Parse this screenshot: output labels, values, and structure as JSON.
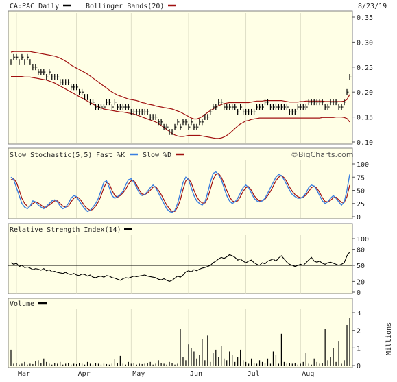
{
  "header": {
    "symbol_label": "CA:PAC Daily",
    "overlay_label": "Bollinger Bands(20)",
    "date": "8/23/19",
    "watermark": "©BigCharts.com"
  },
  "colors": {
    "panel_bg": "#ffffe6",
    "price": "#000000",
    "bollinger": "#a01010",
    "fast_k": "#3a7fe0",
    "slow_d": "#a01010",
    "rsi": "#000000",
    "volume": "#000000"
  },
  "chart_data": [
    {
      "id": "price",
      "type": "line",
      "title": "CA:PAC Daily",
      "ylim": [
        0.1,
        0.35
      ],
      "yticks": [
        "0.35",
        "0.30",
        "0.25",
        "0.20",
        "0.15",
        "0.10"
      ],
      "ytick_values": [
        0.35,
        0.3,
        0.25,
        0.2,
        0.15,
        0.1
      ],
      "x_range": [
        0,
        124
      ],
      "series": [
        {
          "name": "CA:PAC Daily",
          "style": "ohlc-bars",
          "values": [
            0.26,
            0.27,
            0.27,
            0.26,
            0.27,
            0.26,
            0.27,
            0.26,
            0.25,
            0.25,
            0.24,
            0.24,
            0.24,
            0.23,
            0.24,
            0.23,
            0.23,
            0.23,
            0.22,
            0.22,
            0.22,
            0.22,
            0.21,
            0.21,
            0.21,
            0.2,
            0.2,
            0.19,
            0.19,
            0.18,
            0.18,
            0.17,
            0.17,
            0.17,
            0.17,
            0.18,
            0.18,
            0.17,
            0.18,
            0.17,
            0.17,
            0.17,
            0.17,
            0.17,
            0.16,
            0.16,
            0.16,
            0.16,
            0.16,
            0.16,
            0.16,
            0.15,
            0.15,
            0.15,
            0.14,
            0.14,
            0.13,
            0.13,
            0.12,
            0.12,
            0.13,
            0.14,
            0.13,
            0.14,
            0.14,
            0.13,
            0.14,
            0.13,
            0.13,
            0.14,
            0.14,
            0.15,
            0.15,
            0.16,
            0.17,
            0.17,
            0.18,
            0.18,
            0.17,
            0.17,
            0.17,
            0.17,
            0.17,
            0.16,
            0.17,
            0.16,
            0.16,
            0.16,
            0.16,
            0.16,
            0.17,
            0.17,
            0.17,
            0.18,
            0.18,
            0.17,
            0.17,
            0.17,
            0.17,
            0.17,
            0.17,
            0.17,
            0.16,
            0.16,
            0.16,
            0.17,
            0.17,
            0.17,
            0.17,
            0.18,
            0.18,
            0.18,
            0.18,
            0.18,
            0.18,
            0.17,
            0.17,
            0.18,
            0.18,
            0.18,
            0.17,
            0.17,
            0.18,
            0.2,
            0.23
          ]
        },
        {
          "name": "Bollinger Bands(20)",
          "band": "upper",
          "values": [
            0.28,
            0.281,
            0.281,
            0.281,
            0.281,
            0.281,
            0.281,
            0.281,
            0.28,
            0.279,
            0.278,
            0.277,
            0.276,
            0.275,
            0.274,
            0.273,
            0.272,
            0.27,
            0.268,
            0.265,
            0.262,
            0.258,
            0.254,
            0.251,
            0.248,
            0.245,
            0.242,
            0.239,
            0.236,
            0.232,
            0.228,
            0.224,
            0.22,
            0.216,
            0.212,
            0.208,
            0.204,
            0.2,
            0.197,
            0.194,
            0.192,
            0.19,
            0.188,
            0.186,
            0.185,
            0.184,
            0.183,
            0.181,
            0.179,
            0.178,
            0.176,
            0.175,
            0.174,
            0.172,
            0.171,
            0.17,
            0.169,
            0.168,
            0.167,
            0.166,
            0.164,
            0.162,
            0.16,
            0.157,
            0.154,
            0.151,
            0.148,
            0.146,
            0.146,
            0.148,
            0.151,
            0.155,
            0.159,
            0.163,
            0.166,
            0.17,
            0.173,
            0.175,
            0.177,
            0.178,
            0.179,
            0.179,
            0.179,
            0.179,
            0.179,
            0.179,
            0.179,
            0.179,
            0.18,
            0.181,
            0.182,
            0.182,
            0.182,
            0.183,
            0.183,
            0.183,
            0.183,
            0.183,
            0.183,
            0.183,
            0.182,
            0.181,
            0.18,
            0.18,
            0.18,
            0.18,
            0.181,
            0.181,
            0.182,
            0.182,
            0.182,
            0.182,
            0.182,
            0.182,
            0.182,
            0.181,
            0.181,
            0.181,
            0.181,
            0.181,
            0.181,
            0.181,
            0.182,
            0.185,
            0.195
          ]
        },
        {
          "name": "Bollinger Bands(20)",
          "band": "lower",
          "values": [
            0.231,
            0.231,
            0.231,
            0.231,
            0.231,
            0.23,
            0.23,
            0.23,
            0.229,
            0.228,
            0.227,
            0.226,
            0.225,
            0.224,
            0.222,
            0.22,
            0.218,
            0.215,
            0.212,
            0.209,
            0.206,
            0.203,
            0.2,
            0.197,
            0.194,
            0.191,
            0.188,
            0.185,
            0.182,
            0.179,
            0.176,
            0.173,
            0.17,
            0.168,
            0.166,
            0.165,
            0.164,
            0.163,
            0.162,
            0.161,
            0.16,
            0.16,
            0.159,
            0.158,
            0.157,
            0.156,
            0.154,
            0.152,
            0.15,
            0.148,
            0.146,
            0.144,
            0.142,
            0.14,
            0.137,
            0.133,
            0.129,
            0.125,
            0.121,
            0.117,
            0.114,
            0.112,
            0.111,
            0.111,
            0.112,
            0.113,
            0.113,
            0.113,
            0.113,
            0.113,
            0.112,
            0.111,
            0.11,
            0.109,
            0.108,
            0.107,
            0.107,
            0.108,
            0.11,
            0.113,
            0.117,
            0.122,
            0.127,
            0.132,
            0.136,
            0.139,
            0.142,
            0.143,
            0.145,
            0.146,
            0.147,
            0.148,
            0.148,
            0.148,
            0.148,
            0.148,
            0.148,
            0.148,
            0.148,
            0.148,
            0.148,
            0.148,
            0.148,
            0.148,
            0.148,
            0.148,
            0.148,
            0.148,
            0.148,
            0.148,
            0.148,
            0.148,
            0.148,
            0.148,
            0.149,
            0.149,
            0.149,
            0.149,
            0.149,
            0.15,
            0.15,
            0.15,
            0.149,
            0.147,
            0.14
          ]
        }
      ]
    },
    {
      "id": "stochastic",
      "type": "line",
      "title": "Slow Stochastic(5,5)",
      "ylim": [
        0,
        100
      ],
      "yticks": [
        "100",
        "75",
        "50",
        "25",
        "0"
      ],
      "ytick_values": [
        100,
        75,
        50,
        25,
        0
      ],
      "x_range": [
        0,
        124
      ],
      "series": [
        {
          "name": "Fast %K",
          "values": [
            75,
            70,
            55,
            40,
            25,
            18,
            15,
            20,
            30,
            28,
            22,
            18,
            15,
            20,
            25,
            30,
            32,
            28,
            20,
            15,
            18,
            25,
            35,
            40,
            38,
            30,
            22,
            15,
            10,
            12,
            18,
            25,
            35,
            50,
            65,
            68,
            55,
            40,
            35,
            38,
            42,
            48,
            60,
            70,
            72,
            65,
            55,
            45,
            40,
            42,
            48,
            55,
            60,
            55,
            45,
            35,
            25,
            15,
            10,
            8,
            12,
            25,
            45,
            65,
            75,
            70,
            55,
            40,
            30,
            25,
            22,
            28,
            45,
            65,
            82,
            85,
            80,
            70,
            55,
            40,
            30,
            25,
            28,
            35,
            45,
            55,
            60,
            55,
            45,
            35,
            30,
            28,
            30,
            35,
            45,
            55,
            65,
            75,
            80,
            78,
            70,
            60,
            50,
            42,
            38,
            35,
            35,
            38,
            45,
            55,
            60,
            58,
            50,
            40,
            30,
            25,
            28,
            35,
            40,
            35,
            28,
            22,
            28,
            50,
            80
          ]
        },
        {
          "name": "Slow %D",
          "values": [
            70,
            72,
            65,
            50,
            35,
            25,
            20,
            20,
            25,
            28,
            26,
            22,
            18,
            18,
            22,
            26,
            30,
            30,
            25,
            20,
            18,
            20,
            28,
            35,
            38,
            35,
            28,
            20,
            15,
            12,
            14,
            20,
            28,
            40,
            55,
            65,
            62,
            50,
            40,
            37,
            40,
            45,
            52,
            62,
            68,
            68,
            60,
            50,
            43,
            42,
            45,
            50,
            56,
            57,
            50,
            42,
            32,
            22,
            15,
            10,
            10,
            18,
            32,
            52,
            68,
            72,
            64,
            50,
            38,
            30,
            26,
            26,
            35,
            52,
            70,
            80,
            82,
            75,
            63,
            50,
            38,
            30,
            28,
            30,
            38,
            48,
            55,
            57,
            50,
            40,
            34,
            30,
            30,
            33,
            40,
            48,
            58,
            68,
            75,
            78,
            74,
            66,
            56,
            48,
            42,
            38,
            36,
            37,
            41,
            48,
            55,
            58,
            54,
            46,
            36,
            29,
            28,
            31,
            36,
            37,
            32,
            27,
            27,
            38,
            60
          ]
        }
      ]
    },
    {
      "id": "rsi",
      "type": "line",
      "title": "Relative Strength Index(14)",
      "ylim": [
        0,
        100
      ],
      "yticks": [
        "100",
        "80",
        "50",
        "20",
        "0"
      ],
      "ytick_values": [
        100,
        80,
        50,
        20,
        0
      ],
      "reference_line": 50,
      "x_range": [
        0,
        124
      ],
      "series": [
        {
          "name": "Relative Strength Index(14)",
          "values": [
            55,
            52,
            54,
            48,
            50,
            46,
            47,
            45,
            42,
            44,
            43,
            41,
            44,
            40,
            42,
            38,
            39,
            37,
            36,
            35,
            37,
            34,
            33,
            35,
            32,
            31,
            34,
            33,
            30,
            32,
            28,
            27,
            29,
            30,
            28,
            31,
            30,
            27,
            26,
            24,
            22,
            25,
            27,
            26,
            28,
            30,
            29,
            30,
            31,
            32,
            30,
            29,
            28,
            27,
            24,
            23,
            25,
            22,
            20,
            22,
            26,
            30,
            28,
            32,
            38,
            40,
            38,
            42,
            40,
            43,
            45,
            46,
            48,
            50,
            55,
            58,
            62,
            65,
            63,
            66,
            70,
            68,
            65,
            60,
            62,
            58,
            55,
            58,
            60,
            55,
            52,
            50,
            55,
            53,
            58,
            60,
            62,
            58,
            64,
            68,
            62,
            56,
            52,
            50,
            48,
            50,
            52,
            50,
            55,
            60,
            65,
            58,
            56,
            58,
            54,
            52,
            55,
            56,
            54,
            52,
            50,
            52,
            55,
            68,
            75
          ]
        }
      ]
    },
    {
      "id": "volume",
      "type": "bar",
      "title": "Volume",
      "ylabel": "Millions",
      "ylim": [
        0,
        3
      ],
      "yticks": [
        "3",
        "2",
        "1",
        "0"
      ],
      "ytick_values": [
        3,
        2,
        1,
        0
      ],
      "x_range": [
        0,
        124
      ],
      "values": [
        0.9,
        0.1,
        0.15,
        0.05,
        0.1,
        0.2,
        0.05,
        0.1,
        0.08,
        0.25,
        0.3,
        0.15,
        0.4,
        0.2,
        0.1,
        0.05,
        0.15,
        0.1,
        0.2,
        0.05,
        0.1,
        0.15,
        0.05,
        0.1,
        0.08,
        0.15,
        0.1,
        0.05,
        0.2,
        0.1,
        0.05,
        0.15,
        0.1,
        0.05,
        0.1,
        0.08,
        0.05,
        0.1,
        0.35,
        0.15,
        0.55,
        0.1,
        0.05,
        0.2,
        0.1,
        0.15,
        0.05,
        0.1,
        0.08,
        0.1,
        0.15,
        0.2,
        0.05,
        0.1,
        0.3,
        0.15,
        0.1,
        0.05,
        0.2,
        0.15,
        0.05,
        0.1,
        2.1,
        0.5,
        0.3,
        1.2,
        1.0,
        0.8,
        0.4,
        0.6,
        1.5,
        0.3,
        1.7,
        0.2,
        0.7,
        0.9,
        0.5,
        1.1,
        0.4,
        0.3,
        0.8,
        0.6,
        0.2,
        0.5,
        0.9,
        0.3,
        0.2,
        0.1,
        0.4,
        0.15,
        0.1,
        0.3,
        0.2,
        0.15,
        0.4,
        0.1,
        0.8,
        0.6,
        0.1,
        1.8,
        0.2,
        0.1,
        0.15,
        0.1,
        0.15,
        0.05,
        0.1,
        0.2,
        0.7,
        0.1,
        0.05,
        0.4,
        0.2,
        0.1,
        0.15,
        2.1,
        0.3,
        0.5,
        1.0,
        0.2,
        1.4,
        0.1,
        0.3,
        2.3,
        2.7
      ]
    }
  ],
  "x_axis": {
    "months": [
      {
        "label": "Mar",
        "index": 2
      },
      {
        "label": "Apr",
        "index": 24
      },
      {
        "label": "May",
        "index": 44
      },
      {
        "label": "Jun",
        "index": 65
      },
      {
        "label": "Jul",
        "index": 86
      },
      {
        "label": "Aug",
        "index": 106
      }
    ]
  },
  "panels": {
    "stochastic": {
      "title": "Slow Stochastic(5,5)",
      "fast_label": "Fast %K",
      "slow_label": "Slow %D"
    },
    "rsi": {
      "title": "Relative Strength Index(14)"
    },
    "volume": {
      "title": "Volume",
      "unit": "Millions"
    }
  }
}
